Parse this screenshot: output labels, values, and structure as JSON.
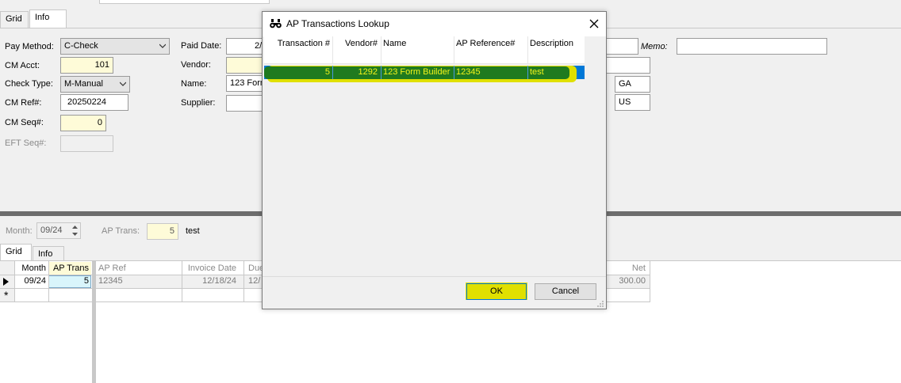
{
  "main": {
    "tabs": [
      "Grid",
      "Info"
    ],
    "pay_method_label": "Pay Method:",
    "pay_method_value": "C-Check",
    "cm_acct_label": "CM Acct:",
    "cm_acct_value": "101",
    "check_type_label": "Check Type:",
    "check_type_value": "M-Manual",
    "cm_ref_label": "CM Ref#:",
    "cm_ref_value": "20250224",
    "cm_seq_label": "CM Seq#:",
    "cm_seq_value": "0",
    "eft_seq_label": "EFT Seq#:",
    "paid_date_label": "Paid Date:",
    "paid_date_value": "2/",
    "vendor_label": "Vendor:",
    "name_label": "Name:",
    "name_value": "123 Form",
    "supplier_label": "Supplier:",
    "memo_label": "Memo:",
    "state_value": "GA",
    "country_value": "US"
  },
  "lower": {
    "month_label": "Month:",
    "month_value": "09/24",
    "ap_trans_label": "AP Trans:",
    "ap_trans_value": "5",
    "ap_trans_desc": "test",
    "tabs": [
      "Grid",
      "Info"
    ],
    "left_grid": {
      "headers": [
        "Month",
        "AP Trans"
      ],
      "row": [
        "09/24",
        "5"
      ],
      "new_row_marker": "*"
    },
    "right_grid": {
      "headers": [
        "AP Ref",
        "Invoice Date",
        "Due",
        "Net"
      ],
      "row": [
        "12345",
        "12/18/24",
        "12/",
        "300.00"
      ]
    }
  },
  "dialog": {
    "title": "AP Transactions Lookup",
    "icon": "binoculars-icon",
    "columns": [
      "Transaction #",
      "Vendor#",
      "Name",
      "AP Reference#",
      "Description"
    ],
    "rows": [
      {
        "transaction": "5",
        "vendor": "1292",
        "name": "123 Form Builder",
        "ap_reference": "12345",
        "description": "test"
      }
    ],
    "ok_label": "OK",
    "cancel_label": "Cancel"
  },
  "colors": {
    "selection": "#0078d7",
    "highlight_green": "#1f7a1f",
    "highlight_yellow": "#e0e000",
    "field_yellow": "#fefbd8",
    "field_cyan": "#d9f5fb"
  }
}
